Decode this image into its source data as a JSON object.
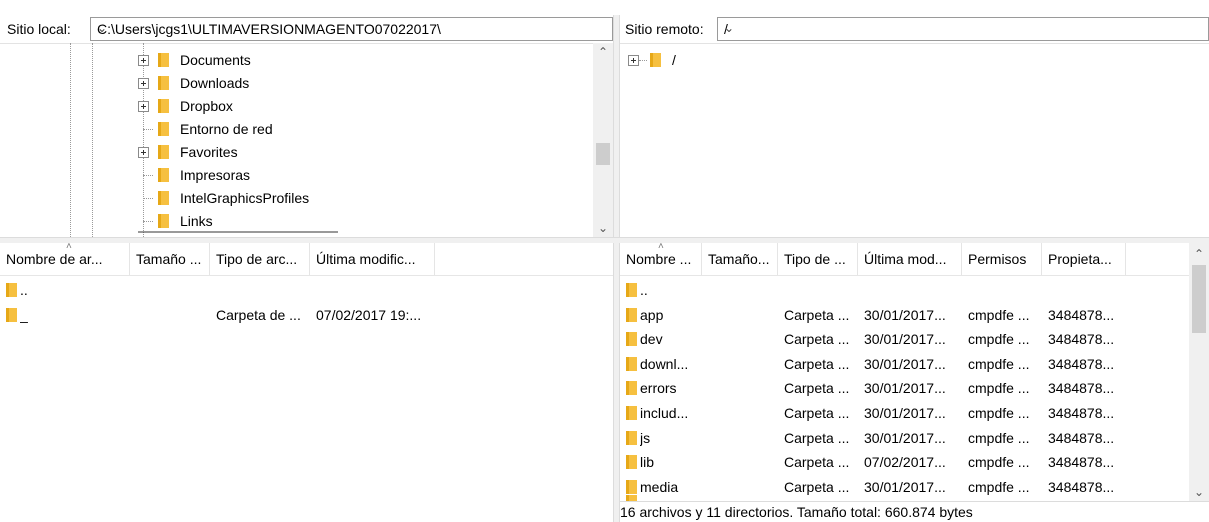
{
  "local": {
    "label": "Sitio local:",
    "path": "C:\\Users\\jcgs1\\ULTIMAVERSIONMAGENTO07022017\\",
    "tree": [
      {
        "label": "Documents",
        "expandable": true,
        "icon": "documents-icon"
      },
      {
        "label": "Downloads",
        "expandable": true,
        "icon": "downloads-icon"
      },
      {
        "label": "Dropbox",
        "expandable": true,
        "icon": "folder-icon"
      },
      {
        "label": "Entorno de red",
        "expandable": false,
        "icon": "folder-icon"
      },
      {
        "label": "Favorites",
        "expandable": true,
        "icon": "favorites-icon"
      },
      {
        "label": "Impresoras",
        "expandable": false,
        "icon": "folder-icon"
      },
      {
        "label": "IntelGraphicsProfiles",
        "expandable": false,
        "icon": "folder-icon"
      },
      {
        "label": "Links",
        "expandable": false,
        "icon": "links-icon"
      }
    ],
    "columns": [
      "Nombre de ar...",
      "Tamaño ...",
      "Tipo de arc...",
      "Última modific..."
    ],
    "rows": [
      {
        "name": "..",
        "size": "",
        "type": "",
        "modified": ""
      },
      {
        "name": "_",
        "size": "",
        "type": "Carpeta de ...",
        "modified": "07/02/2017 19:..."
      }
    ]
  },
  "remote": {
    "label": "Sitio remoto:",
    "path": "/",
    "tree": [
      {
        "label": "/",
        "expandable": true,
        "icon": "folder-icon"
      }
    ],
    "columns": [
      "Nombre ...",
      "Tamaño...",
      "Tipo de ...",
      "Última mod...",
      "Permisos",
      "Propieta..."
    ],
    "rows": [
      {
        "name": "..",
        "size": "",
        "type": "",
        "modified": "",
        "perms": "",
        "owner": ""
      },
      {
        "name": "app",
        "size": "",
        "type": "Carpeta ...",
        "modified": "30/01/2017...",
        "perms": "cmpdfe ...",
        "owner": "3484878..."
      },
      {
        "name": "dev",
        "size": "",
        "type": "Carpeta ...",
        "modified": "30/01/2017...",
        "perms": "cmpdfe ...",
        "owner": "3484878..."
      },
      {
        "name": "downl...",
        "size": "",
        "type": "Carpeta ...",
        "modified": "30/01/2017...",
        "perms": "cmpdfe ...",
        "owner": "3484878..."
      },
      {
        "name": "errors",
        "size": "",
        "type": "Carpeta ...",
        "modified": "30/01/2017...",
        "perms": "cmpdfe ...",
        "owner": "3484878..."
      },
      {
        "name": "includ...",
        "size": "",
        "type": "Carpeta ...",
        "modified": "30/01/2017...",
        "perms": "cmpdfe ...",
        "owner": "3484878..."
      },
      {
        "name": "js",
        "size": "",
        "type": "Carpeta ...",
        "modified": "30/01/2017...",
        "perms": "cmpdfe ...",
        "owner": "3484878..."
      },
      {
        "name": "lib",
        "size": "",
        "type": "Carpeta ...",
        "modified": "07/02/2017...",
        "perms": "cmpdfe ...",
        "owner": "3484878..."
      },
      {
        "name": "media",
        "size": "",
        "type": "Carpeta ...",
        "modified": "30/01/2017...",
        "perms": "cmpdfe ...",
        "owner": "3484878..."
      }
    ],
    "status": "16 archivos y 11 directorios. Tamaño total: 660.874 bytes"
  },
  "colors": {
    "folder": "#f6c040",
    "folder_edge": "#e6a817",
    "scroll_track": "#f0f0f0",
    "scroll_thumb": "#cdcdcd",
    "border": "#9a9a9a"
  }
}
